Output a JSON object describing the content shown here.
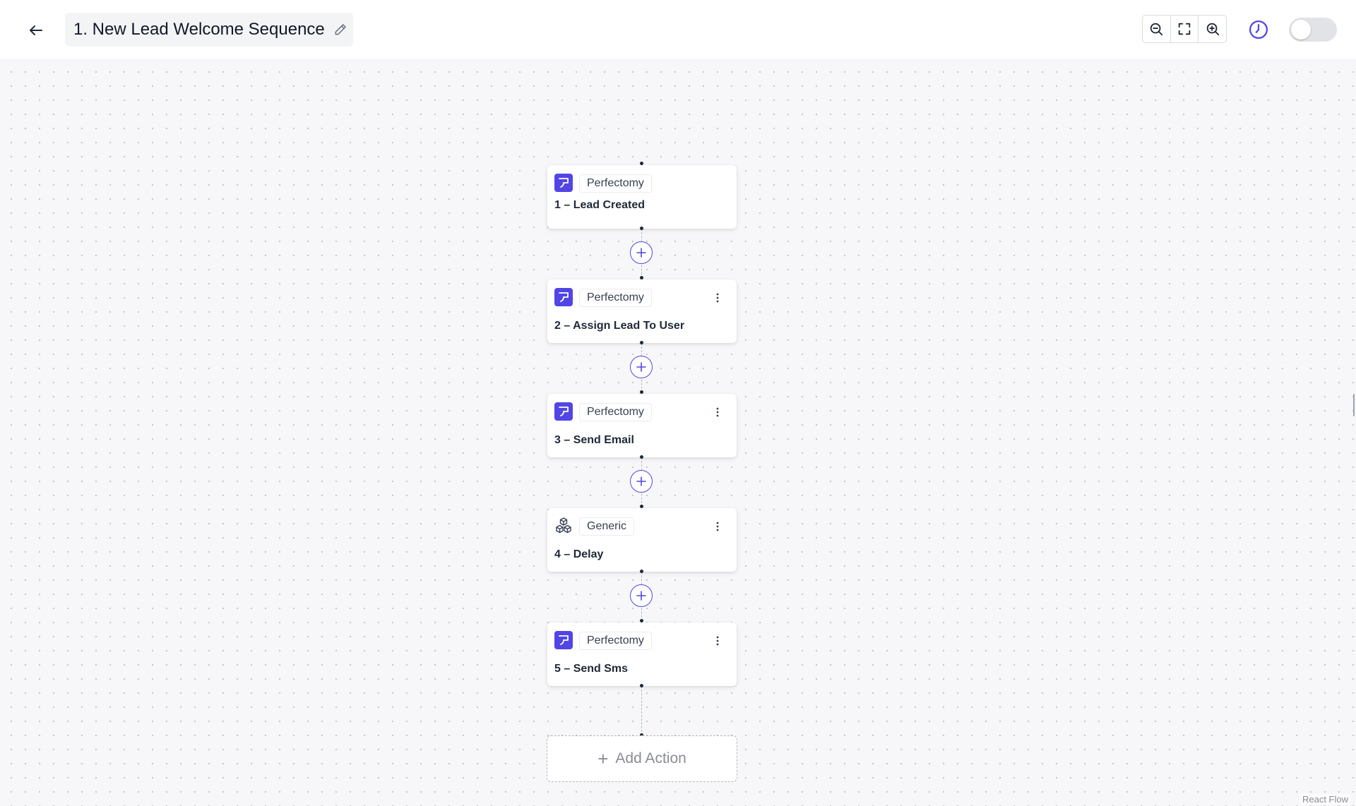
{
  "header": {
    "title": "1. New Lead Welcome Sequence",
    "back_icon": "arrow-left-icon",
    "edit_icon": "pencil-icon",
    "zoom_controls": [
      "zoom-out-icon",
      "fit-view-icon",
      "zoom-in-icon"
    ],
    "history_icon": "clock-icon",
    "active_toggle": "off"
  },
  "nodes": [
    {
      "app": "Perfectomy",
      "title": "1 – Lead Created",
      "icon": "perfectomy-logo-icon",
      "has_menu": false
    },
    {
      "app": "Perfectomy",
      "title": "2 – Assign Lead To User",
      "icon": "perfectomy-logo-icon",
      "has_menu": true
    },
    {
      "app": "Perfectomy",
      "title": "3 – Send Email",
      "icon": "perfectomy-logo-icon",
      "has_menu": true
    },
    {
      "app": "Generic",
      "title": "4 – Delay",
      "icon": "cubes-icon",
      "has_menu": true
    },
    {
      "app": "Perfectomy",
      "title": "5 – Send Sms",
      "icon": "perfectomy-logo-icon",
      "has_menu": true
    }
  ],
  "add_action_label": "Add Action",
  "attribution": "React Flow",
  "colors": {
    "accent": "#5145e5",
    "canvas_bg": "#f7f7f9",
    "toggle_off": "#e2e3e6"
  }
}
